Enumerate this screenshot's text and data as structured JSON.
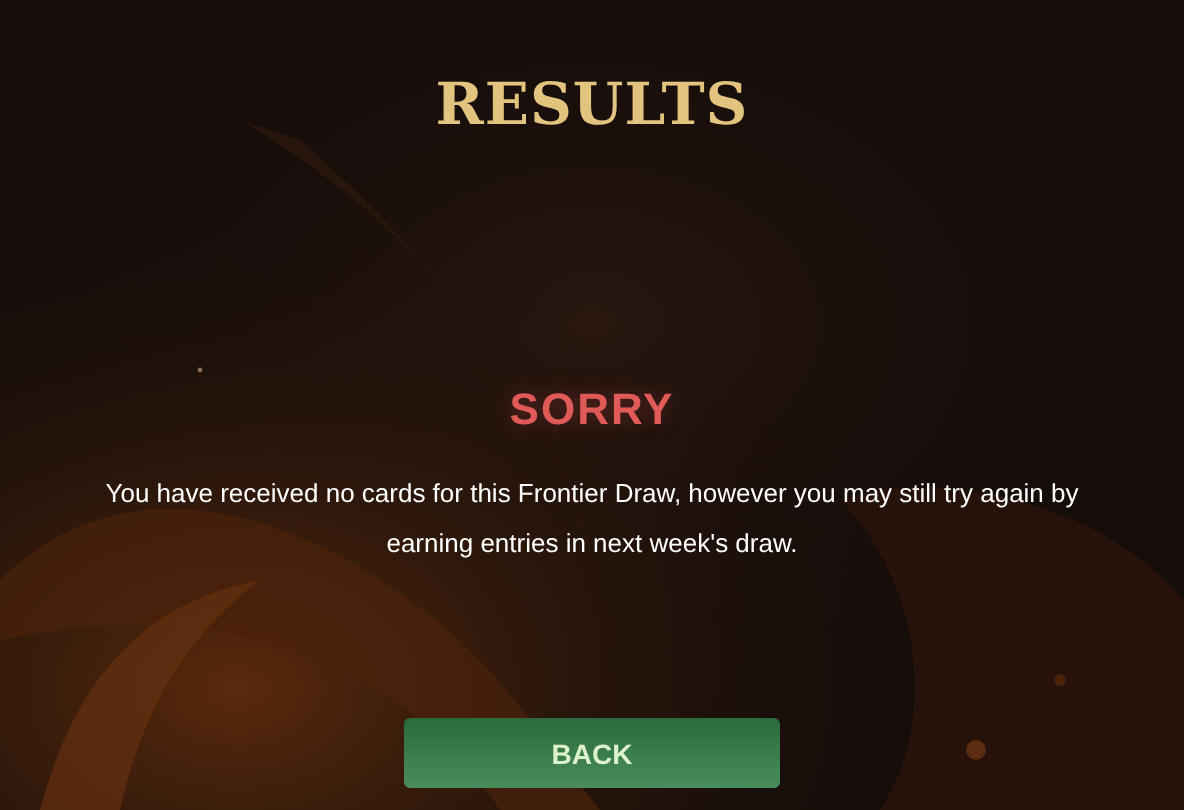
{
  "title": "RESULTS",
  "result": {
    "heading": "SORRY",
    "message": "You have received no cards for this Frontier Draw, however you may still try again by earning entries in next week's draw."
  },
  "buttons": [
    {
      "label": "BACK"
    }
  ]
}
